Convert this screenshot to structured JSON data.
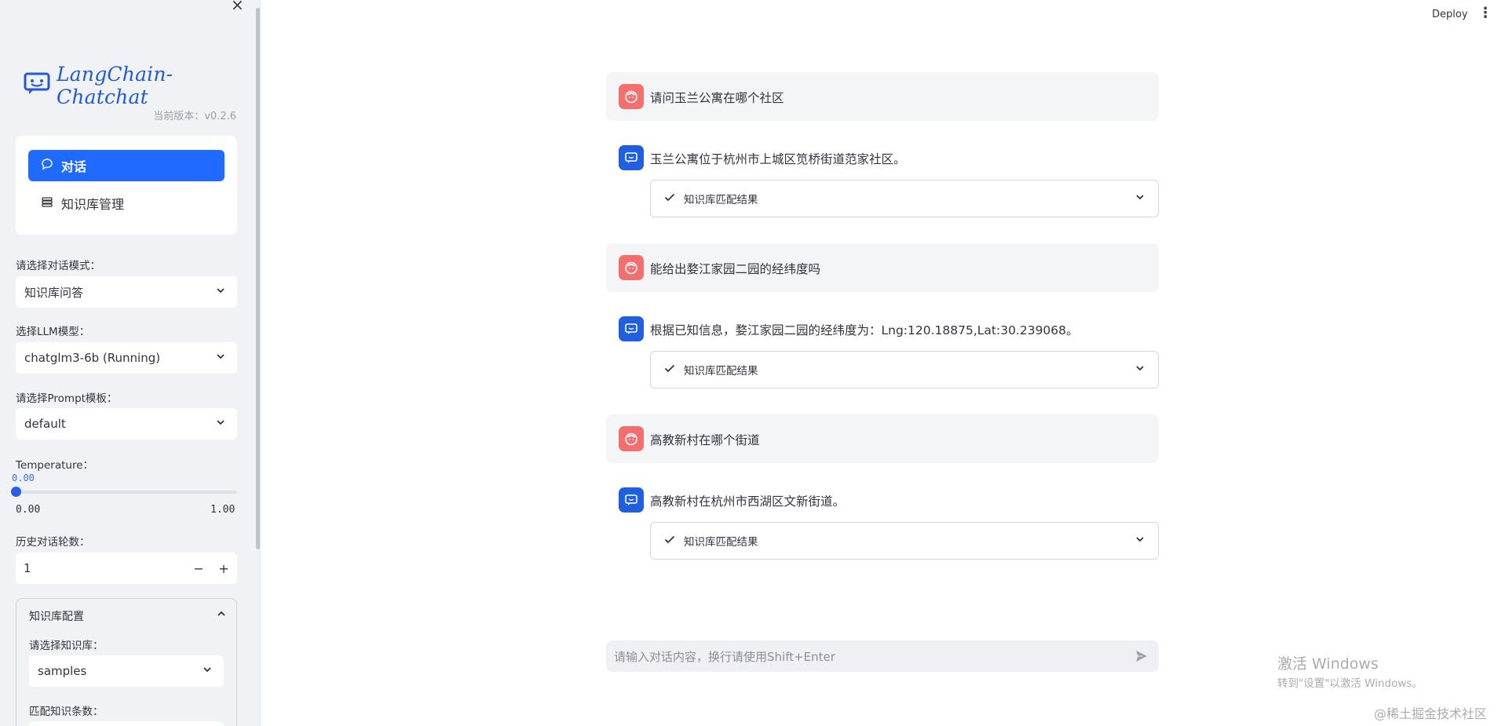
{
  "sidebar": {
    "close_glyph": "×",
    "logo_text": "LangChain-Chatchat",
    "version": "当前版本：v0.2.6",
    "menu": [
      {
        "label": "对话",
        "icon": "chat-bubble-icon"
      },
      {
        "label": "知识库管理",
        "icon": "database-icon"
      }
    ],
    "dialog_mode": {
      "label": "请选择对话模式：",
      "value": "知识库问答"
    },
    "llm_model": {
      "label": "选择LLM模型：",
      "value": "chatglm3-6b (Running)"
    },
    "prompt_template": {
      "label": "请选择Prompt模板：",
      "value": "default"
    },
    "temperature": {
      "label": "Temperature：",
      "current": "0.00",
      "min": "0.00",
      "max": "1.00",
      "value": 0.0
    },
    "history": {
      "label": "历史对话轮数：",
      "value": "1",
      "minus": "−",
      "plus": "+"
    },
    "kb_config": {
      "title": "知识库配置",
      "kb_select": {
        "label": "请选择知识库：",
        "value": "samples"
      },
      "match_count_label": "匹配知识条数："
    }
  },
  "header": {
    "deploy": "Deploy",
    "menu_glyph": "⋮"
  },
  "messages": [
    {
      "role": "user",
      "text": "请问玉兰公寓在哪个社区"
    },
    {
      "role": "assistant",
      "text": "玉兰公寓位于杭州市上城区笕桥街道范家社区。",
      "expander": "知识库匹配结果"
    },
    {
      "role": "user",
      "text": "能给出婺江家园二园的经纬度吗"
    },
    {
      "role": "assistant",
      "text": "根据已知信息，婺江家园二园的经纬度为：Lng:120.18875,Lat:30.239068。",
      "expander": "知识库匹配结果"
    },
    {
      "role": "user",
      "text": "高教新村在哪个街道"
    },
    {
      "role": "assistant",
      "text": "高教新村在杭州市西湖区文新街道。",
      "expander": "知识库匹配结果"
    }
  ],
  "chat_input": {
    "placeholder": "请输入对话内容，换行请使用Shift+Enter"
  },
  "overlay": {
    "activate_title": "激活 Windows",
    "activate_sub": "转到\"设置\"以激活 Windows。",
    "watermark": "@稀土掘金技术社区"
  },
  "colors": {
    "accent": "#1f6bff",
    "user_avatar": "#f46e6e",
    "bot_avatar": "#1f5fe0"
  }
}
